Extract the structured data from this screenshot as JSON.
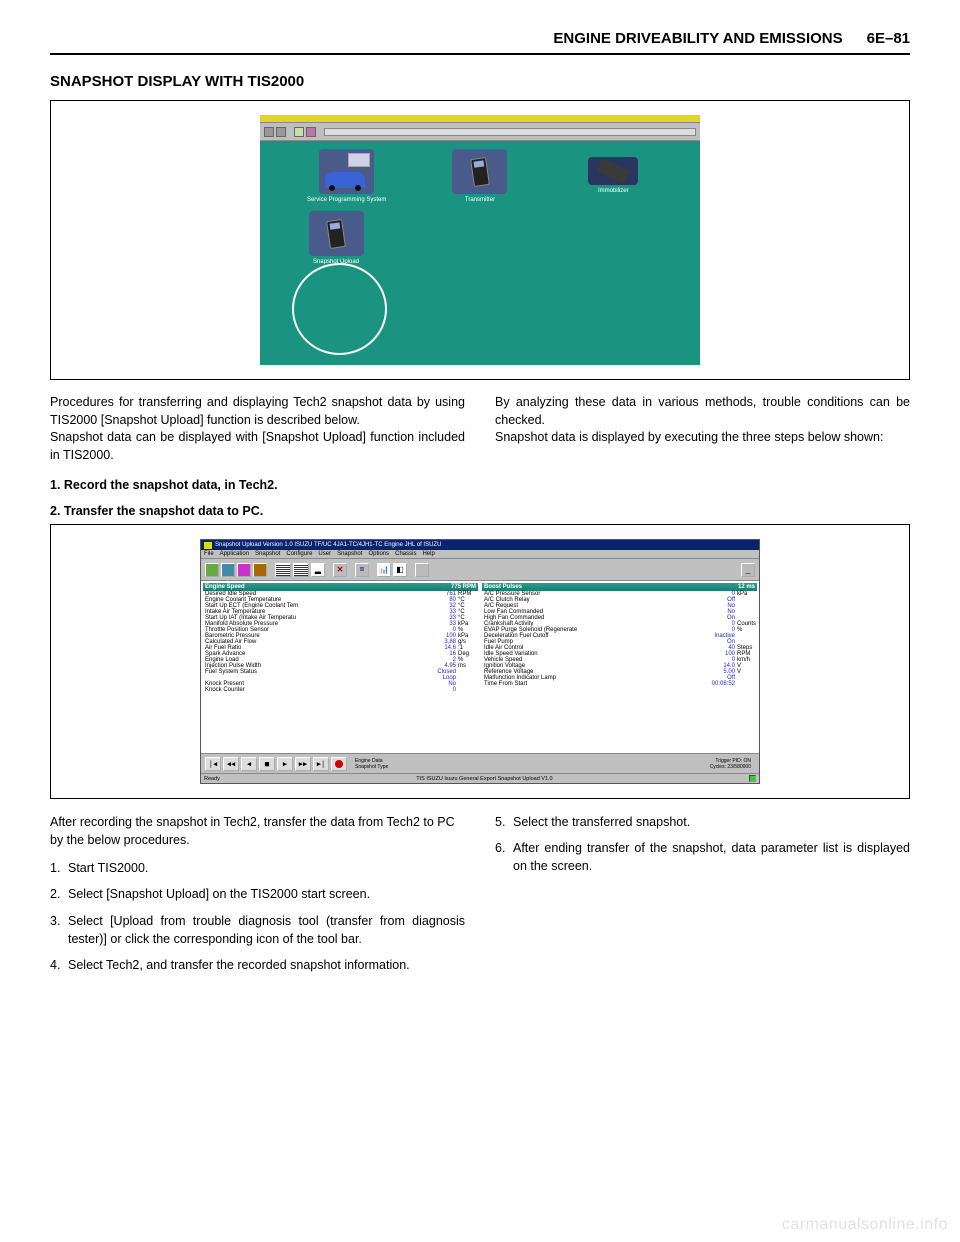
{
  "header": {
    "title": "ENGINE DRIVEABILITY AND EMISSIONS",
    "page_ref": "6E–81"
  },
  "section": {
    "title": "SNAPSHOT DISPLAY WITH TIS2000"
  },
  "fig1": {
    "apps": {
      "spd": "Service Programming System",
      "transmitter": "Transmitter",
      "immobilizer": "Immobilizer",
      "snapshot": "Snapshot Upload"
    }
  },
  "para": {
    "left1": "Procedures for transferring and displaying Tech2 snapshot data by using TIS2000 [Snapshot Upload] function is described below.",
    "left2": "Snapshot data can be displayed with [Snapshot Upload] function included in TIS2000.",
    "right1": "By analyzing these data in various methods, trouble conditions can be checked.",
    "right2": "Snapshot data is displayed by executing the three steps below shown:"
  },
  "step1": "1. Record the snapshot data, in Tech2.",
  "step2": "2. Transfer the snapshot data to PC.",
  "snap": {
    "window_title": "Snapshot Upload Version 1.0  ISUZU TF/UC  4JA1-TC/4JH1-TC  Engine JHL of ISUZU",
    "menu": [
      "File",
      "Application",
      "Snapshot",
      "Configure",
      "User",
      "Snapshot",
      "Options",
      "Chassis",
      "Help"
    ],
    "hdr_left_l": "Engine Speed",
    "hdr_left_r": "775 RPM",
    "hdr_right_l": "Boost Pulses",
    "hdr_right_r": "12 ms",
    "left_data": [
      {
        "l": "Desired Idle Speed",
        "v": "761",
        "u": "RPM"
      },
      {
        "l": "Engine Coolant Temperature",
        "v": "80",
        "u": "°C"
      },
      {
        "l": "Start Up ECT (Engine Coolant Tem",
        "v": "32",
        "u": "°C"
      },
      {
        "l": "Intake Air Temperature",
        "v": "33",
        "u": "°C"
      },
      {
        "l": "Start Up IAT (Intake Air Temperatu",
        "v": "33",
        "u": "°C"
      },
      {
        "l": "Manifold Absolute Pressure",
        "v": "33",
        "u": "kPa"
      },
      {
        "l": "Throttle Position Sensor",
        "v": "0",
        "u": "%"
      },
      {
        "l": "Barometric Pressure",
        "v": "100",
        "u": "kPa"
      },
      {
        "l": "Calculated Air Flow",
        "v": "3.88",
        "u": "g/s"
      },
      {
        "l": "Air Fuel Ratio",
        "v": "14.6",
        "u": ":1"
      },
      {
        "l": "Spark Advance",
        "v": "16",
        "u": "Deg"
      },
      {
        "l": "Engine Load",
        "v": "2",
        "u": "%"
      },
      {
        "l": "Injection Pulse Width",
        "v": "4.95",
        "u": "ms"
      },
      {
        "l": "Fuel System Status",
        "v": "Closed Loop",
        "u": ""
      },
      {
        "l": "Knock Present",
        "v": "No",
        "u": ""
      },
      {
        "l": "Knock Counter",
        "v": "0",
        "u": ""
      }
    ],
    "right_data": [
      {
        "l": "A/C Pressure Sensor",
        "v": "0",
        "u": "kPa"
      },
      {
        "l": "A/C Clutch Relay",
        "v": "Off",
        "u": ""
      },
      {
        "l": "A/C Request",
        "v": "No",
        "u": ""
      },
      {
        "l": "Low Fan Commanded",
        "v": "No",
        "u": ""
      },
      {
        "l": "High Fan Commanded",
        "v": "On",
        "u": ""
      },
      {
        "l": "Crankshaft Activity",
        "v": "0",
        "u": "Counts"
      },
      {
        "l": "EVAP Purge Solenoid (Regenerate",
        "v": "0",
        "u": "%"
      },
      {
        "l": "Deceleration Fuel Cutoff",
        "v": "Inactive",
        "u": ""
      },
      {
        "l": "Fuel Pump",
        "v": "On",
        "u": ""
      },
      {
        "l": "Idle Air Control",
        "v": "40",
        "u": "Steps"
      },
      {
        "l": "Idle Speed Variation",
        "v": "100",
        "u": "RPM"
      },
      {
        "l": "Vehicle Speed",
        "v": "0",
        "u": "km/h"
      },
      {
        "l": "Ignition Voltage",
        "v": "14.0",
        "u": "V"
      },
      {
        "l": "Reference Voltage",
        "v": "5.00",
        "u": "V"
      },
      {
        "l": "Malfunction Indicator Lamp",
        "v": "Off",
        "u": ""
      },
      {
        "l": "Time From Start",
        "v": "00:08:52",
        "u": ""
      }
    ],
    "info1": "Engine Data",
    "info2": "Snapshot Type",
    "right_info1": "Trigger PID: ON",
    "right_info2": "Cycles: 23/580000",
    "status_left": "Ready",
    "status_mid": "TIS    ISUZU      Isuzu General Export Snapshot Upload V1.0"
  },
  "bottom": {
    "intro": "After recording the snapshot in Tech2, transfer the data from Tech2 to PC by the below procedures.",
    "s1": "Start TIS2000.",
    "s2": "Select [Snapshot Upload] on the TIS2000 start screen.",
    "s3": "Select [Upload from trouble diagnosis tool (transfer from diagnosis tester)] or click the corresponding icon of the tool bar.",
    "s4": "Select Tech2, and transfer the recorded snapshot information.",
    "s5": "Select the transferred snapshot.",
    "s6": "After ending transfer of the snapshot, data parameter list is displayed on the screen."
  },
  "watermark": "carmanualsonline.info"
}
